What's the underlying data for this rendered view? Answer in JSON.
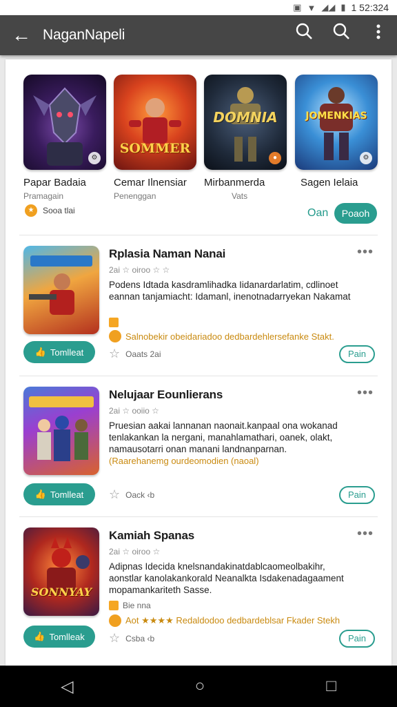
{
  "status": {
    "time": "1 52:324"
  },
  "appbar": {
    "title": "NaganNapeli"
  },
  "featured": [
    {
      "name": "Papar Badaia",
      "sub": "Pramagain",
      "art_text": ""
    },
    {
      "name": "Cemar Ilnensiar",
      "sub": "Penenggan",
      "art_text": "SOMMER"
    },
    {
      "name": "Mirbanmerda",
      "sub": "Vats",
      "art_text": "DOMNIA"
    },
    {
      "name": "Sagen Ielaia",
      "sub": "",
      "art_text": "JOMENKIAS"
    }
  ],
  "featured_footer": {
    "dev": "Sooa tlai",
    "open_text": "Oan",
    "pill_label": "Poaoh"
  },
  "items": [
    {
      "title": "Rplasia Naman Nanai",
      "meta": "2ai ☆ oiroo ☆ ☆",
      "desc": "Podens Idtada kasdramlihadka Iidanardarlatim, cdlinoet eannan tanjamiacht: Idamanl, inenotnadarryekan Nakamat",
      "tag": "",
      "promo": "Salnobekir obeidariadoo dedbardehlersefanke Stakt.",
      "install": "Tomlleat",
      "rating_text": "Oaats  2ai",
      "run": "Pain"
    },
    {
      "title": "Nelujaar Eounlierans",
      "meta": "2ai ☆ ooiio ☆",
      "desc": "Pruesian aakai lannanan naonait.kanpaal ona wokanad tenlakankan la nergani, manahlamathari, oanek, olakt, namausotarri onan manani landnanparnan.",
      "tag": "",
      "promo": "(Raarehanemg ourdeomodien (naoal)",
      "install": "Tomlleat",
      "rating_text": "Oack  ‹b",
      "run": "Pain"
    },
    {
      "title": "Kamiah Spanas",
      "meta": "2ai ☆ oiroo ☆",
      "desc": "Adipnas Idecida knelsnandakinatdablcaomeolbakihr, aonstlar kanolakankorald Neanalkta Isdakenadagaament mopamankariteth Sasse.",
      "tag": "Bie nna",
      "promo": "Aot ★★★★ Redaldodoo dedbardeblsar Fkader Stekh",
      "install": "Tomlleak",
      "rating_text": "Csba  ‹b",
      "run": "Pain"
    }
  ],
  "nav": {
    "back": "◁",
    "home": "○",
    "recents": "□"
  }
}
